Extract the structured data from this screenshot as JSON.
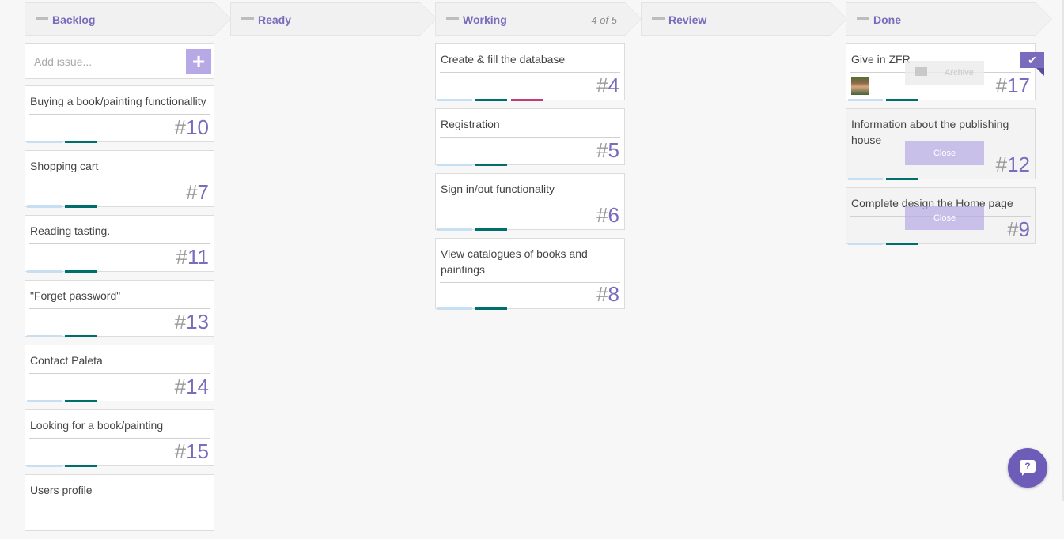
{
  "columns": [
    {
      "title": "Backlog",
      "wip": ""
    },
    {
      "title": "Ready",
      "wip": ""
    },
    {
      "title": "Working",
      "wip": "4 of 5"
    },
    {
      "title": "Review",
      "wip": ""
    },
    {
      "title": "Done",
      "wip": ""
    }
  ],
  "add_issue": {
    "placeholder": "Add issue...",
    "button": "+"
  },
  "backlog": [
    {
      "title": "Buying a book/painting functionallity",
      "number": "10"
    },
    {
      "title": "Shopping cart",
      "number": "7"
    },
    {
      "title": "Reading tasting.",
      "number": "11"
    },
    {
      "title": "\"Forget password\"",
      "number": "13"
    },
    {
      "title": "Contact Paleta",
      "number": "14"
    },
    {
      "title": "Looking for a book/painting",
      "number": "15"
    },
    {
      "title": "Users profile",
      "number": ""
    }
  ],
  "working": [
    {
      "title": "Create & fill the database",
      "number": "4"
    },
    {
      "title": "Registration",
      "number": "5"
    },
    {
      "title": "Sign in/out functionality",
      "number": "6"
    },
    {
      "title": "View catalogues of books and paintings",
      "number": "8"
    }
  ],
  "done": [
    {
      "title": "Give in ZFR",
      "number": "17",
      "action": "Archive"
    },
    {
      "title": "Information about the publishing house",
      "number": "12",
      "action": "Close"
    },
    {
      "title": "Complete design the Home page",
      "number": "9",
      "action": "Close"
    }
  ],
  "hash": "#",
  "icons": {
    "add": "plus-icon",
    "check": "checkmark-icon",
    "archive": "archive-icon",
    "help": "help-chat-icon"
  },
  "colors": {
    "accent": "#7b6bbd",
    "teal": "#006e6a",
    "pink": "#c23c79",
    "light_blue": "#c6dff2"
  }
}
